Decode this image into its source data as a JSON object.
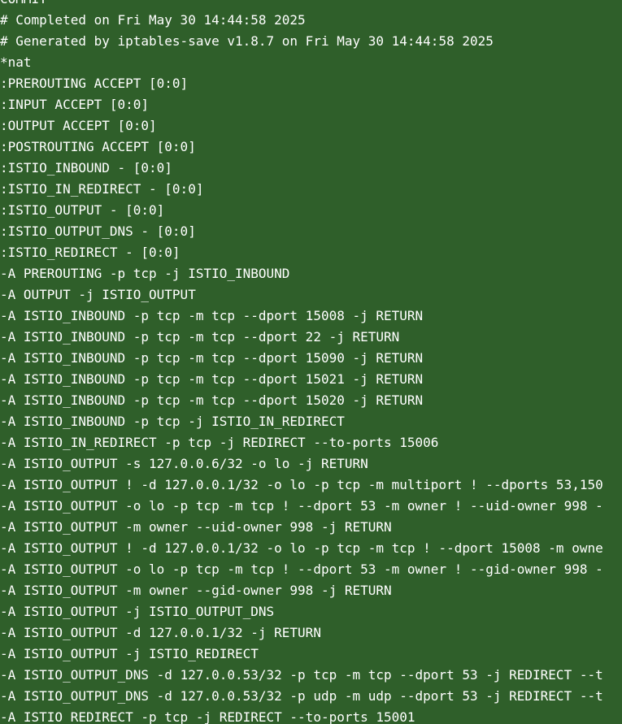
{
  "colors": {
    "background": "#2f5f2a",
    "text": "#ffffff"
  },
  "terminal": {
    "lines": [
      "COMMIT",
      "# Completed on Fri May 30 14:44:58 2025",
      "# Generated by iptables-save v1.8.7 on Fri May 30 14:44:58 2025",
      "*nat",
      ":PREROUTING ACCEPT [0:0]",
      ":INPUT ACCEPT [0:0]",
      ":OUTPUT ACCEPT [0:0]",
      ":POSTROUTING ACCEPT [0:0]",
      ":ISTIO_INBOUND - [0:0]",
      ":ISTIO_IN_REDIRECT - [0:0]",
      ":ISTIO_OUTPUT - [0:0]",
      ":ISTIO_OUTPUT_DNS - [0:0]",
      ":ISTIO_REDIRECT - [0:0]",
      "-A PREROUTING -p tcp -j ISTIO_INBOUND",
      "-A OUTPUT -j ISTIO_OUTPUT",
      "-A ISTIO_INBOUND -p tcp -m tcp --dport 15008 -j RETURN",
      "-A ISTIO_INBOUND -p tcp -m tcp --dport 22 -j RETURN",
      "-A ISTIO_INBOUND -p tcp -m tcp --dport 15090 -j RETURN",
      "-A ISTIO_INBOUND -p tcp -m tcp --dport 15021 -j RETURN",
      "-A ISTIO_INBOUND -p tcp -m tcp --dport 15020 -j RETURN",
      "-A ISTIO_INBOUND -p tcp -j ISTIO_IN_REDIRECT",
      "-A ISTIO_IN_REDIRECT -p tcp -j REDIRECT --to-ports 15006",
      "-A ISTIO_OUTPUT -s 127.0.0.6/32 -o lo -j RETURN",
      "-A ISTIO_OUTPUT ! -d 127.0.0.1/32 -o lo -p tcp -m multiport ! --dports 53,150",
      "-A ISTIO_OUTPUT -o lo -p tcp -m tcp ! --dport 53 -m owner ! --uid-owner 998 -",
      "-A ISTIO_OUTPUT -m owner --uid-owner 998 -j RETURN",
      "-A ISTIO_OUTPUT ! -d 127.0.0.1/32 -o lo -p tcp -m tcp ! --dport 15008 -m owne",
      "-A ISTIO_OUTPUT -o lo -p tcp -m tcp ! --dport 53 -m owner ! --gid-owner 998 -",
      "-A ISTIO_OUTPUT -m owner --gid-owner 998 -j RETURN",
      "-A ISTIO_OUTPUT -j ISTIO_OUTPUT_DNS",
      "-A ISTIO_OUTPUT -d 127.0.0.1/32 -j RETURN",
      "-A ISTIO_OUTPUT -j ISTIO_REDIRECT",
      "-A ISTIO_OUTPUT_DNS -d 127.0.0.53/32 -p tcp -m tcp --dport 53 -j REDIRECT --t",
      "-A ISTIO_OUTPUT_DNS -d 127.0.0.53/32 -p udp -m udp --dport 53 -j REDIRECT --t",
      "-A ISTIO_REDIRECT -p tcp -j REDIRECT --to-ports 15001"
    ]
  }
}
